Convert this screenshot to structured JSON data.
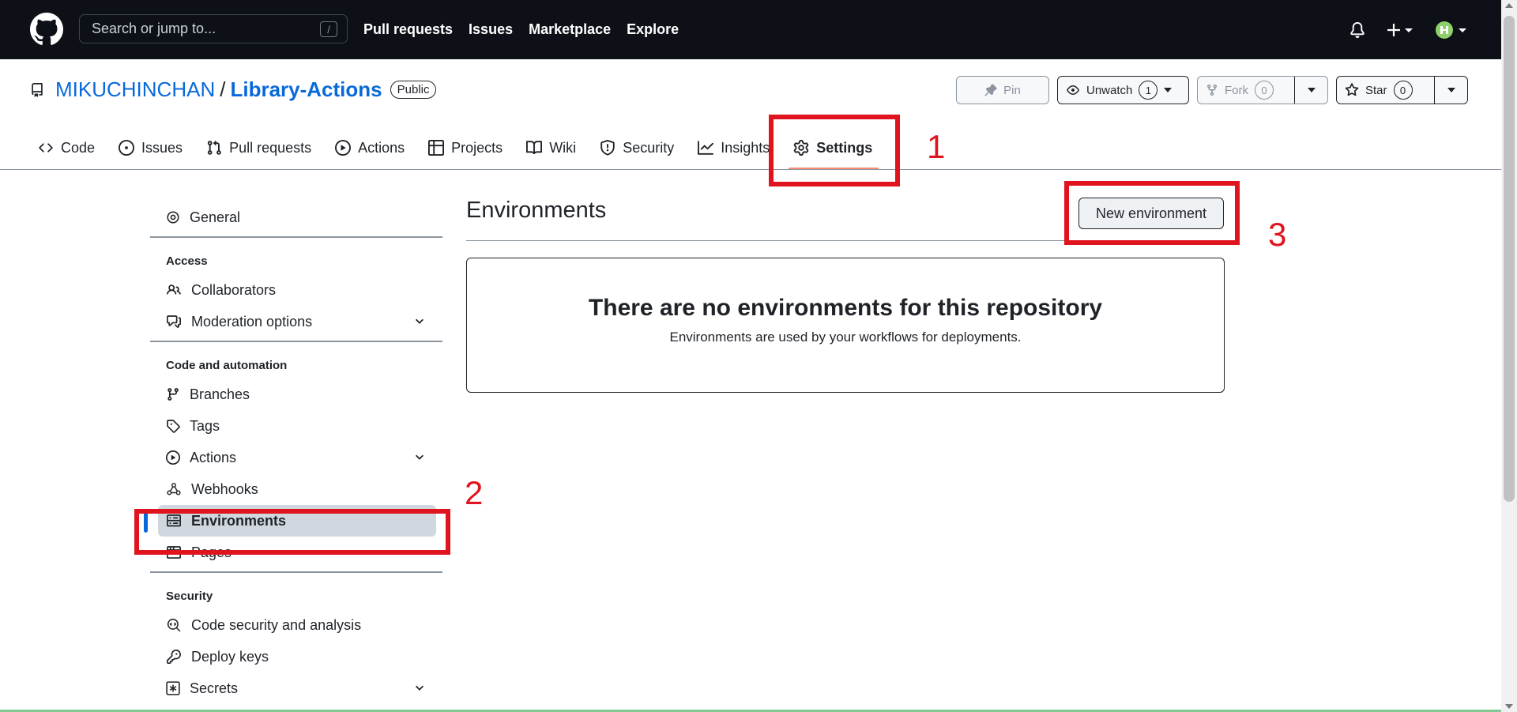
{
  "header": {
    "search_placeholder": "Search or jump to...",
    "search_shortcut": "/",
    "nav": [
      "Pull requests",
      "Issues",
      "Marketplace",
      "Explore"
    ]
  },
  "repo": {
    "owner": "MIKUCHINCHAN",
    "separator": "/",
    "name": "Library-Actions",
    "visibility": "Public",
    "pin_label": "Pin",
    "unwatch_label": "Unwatch",
    "unwatch_count": "1",
    "fork_label": "Fork",
    "fork_count": "0",
    "star_label": "Star",
    "star_count": "0"
  },
  "tabs": {
    "code": "Code",
    "issues": "Issues",
    "pull_requests": "Pull requests",
    "actions": "Actions",
    "projects": "Projects",
    "wiki": "Wiki",
    "security": "Security",
    "insights": "Insights",
    "settings": "Settings"
  },
  "sidebar": {
    "general": "General",
    "access_heading": "Access",
    "collaborators": "Collaborators",
    "moderation": "Moderation options",
    "code_heading": "Code and automation",
    "branches": "Branches",
    "tags": "Tags",
    "actions": "Actions",
    "webhooks": "Webhooks",
    "environments": "Environments",
    "pages": "Pages",
    "security_heading": "Security",
    "code_security": "Code security and analysis",
    "deploy_keys": "Deploy keys",
    "secrets": "Secrets"
  },
  "main": {
    "title": "Environments",
    "new_button": "New environment",
    "empty_title": "There are no environments for this repository",
    "empty_desc": "Environments are used by your workflows for deployments."
  },
  "annotations": {
    "one": "1",
    "two": "2",
    "three": "3"
  },
  "colors": {
    "header_bg": "#0d1117",
    "link": "#0969da",
    "annotation_red": "#e0141e",
    "selected_tab_underline": "#fd8c73"
  }
}
